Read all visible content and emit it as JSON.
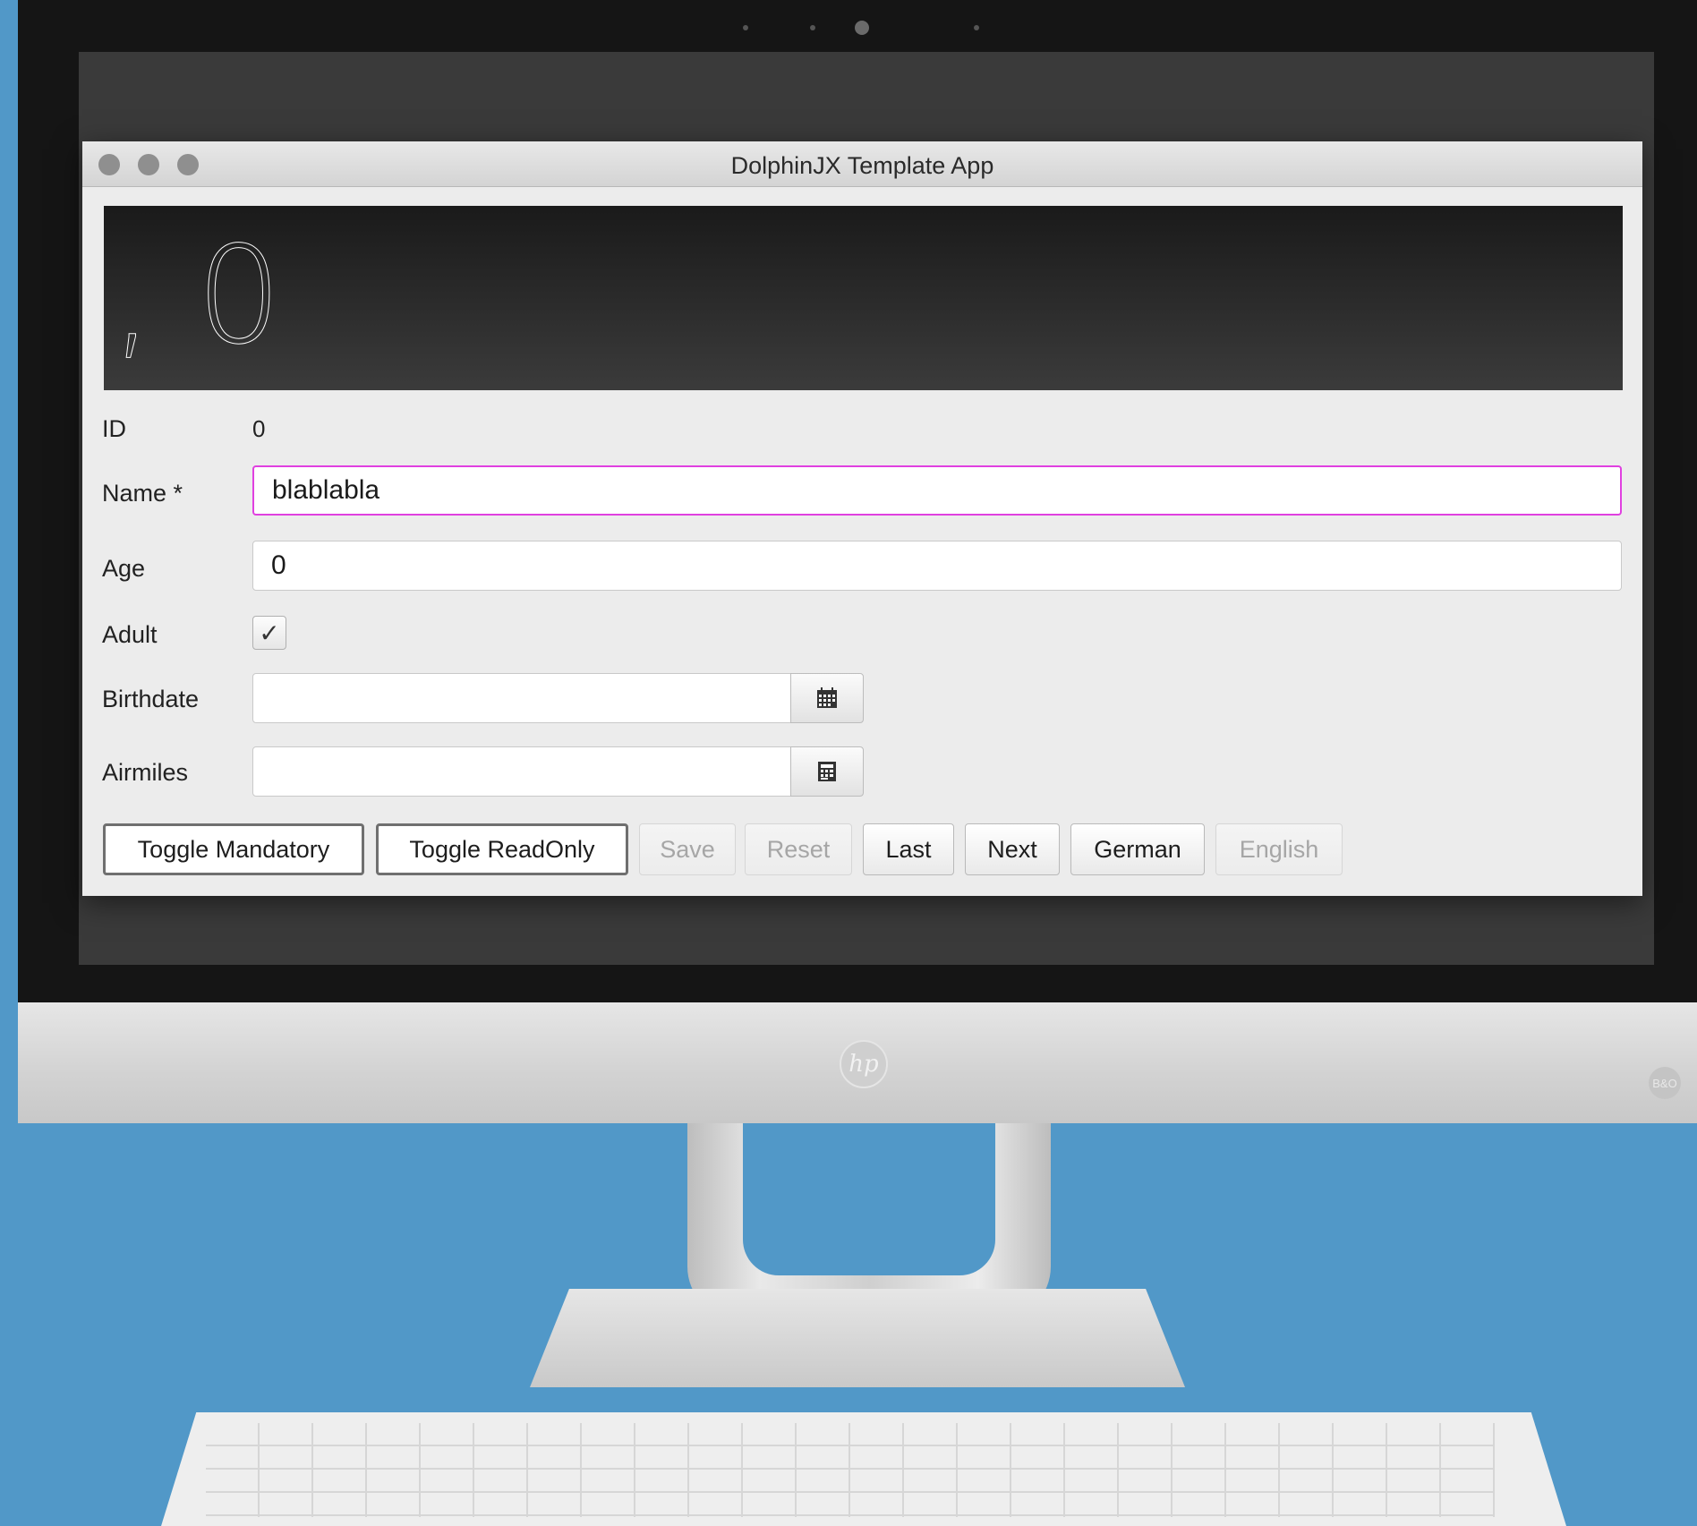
{
  "window": {
    "title": "DolphinJX Template App"
  },
  "header": {
    "text": ", 0"
  },
  "form": {
    "id": {
      "label": "ID",
      "value": "0"
    },
    "name": {
      "label": "Name *",
      "value": "blablabla"
    },
    "age": {
      "label": "Age",
      "value": "0"
    },
    "adult": {
      "label": "Adult",
      "checked": true,
      "mark": "✓"
    },
    "birthdate": {
      "label": "Birthdate",
      "value": "",
      "icon": "calendar-icon"
    },
    "airmiles": {
      "label": "Airmiles",
      "value": "",
      "icon": "calculator-icon"
    }
  },
  "buttons": {
    "toggle_mandatory": "Toggle Mandatory",
    "toggle_readonly": "Toggle ReadOnly",
    "save": "Save",
    "reset": "Reset",
    "last": "Last",
    "next": "Next",
    "german": "German",
    "english": "English"
  },
  "monitor": {
    "logo": "hp",
    "badge": "B&O"
  },
  "colors": {
    "background": "#5198c8",
    "focus_border": "#e040e0",
    "header_bg": "#2a2a2a"
  }
}
